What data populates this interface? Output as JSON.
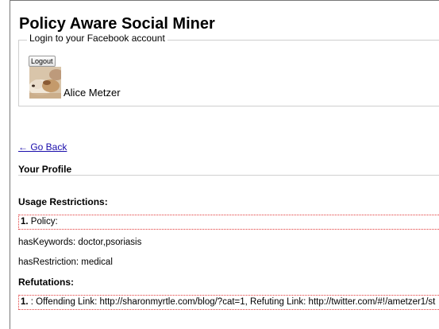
{
  "app": {
    "title": "Policy Aware Social Miner"
  },
  "login": {
    "legend": "Login to your Facebook account",
    "logout_label": "Logout",
    "user_name": "Alice Metzer"
  },
  "nav": {
    "go_back": "← Go Back"
  },
  "profile": {
    "title": "Your Profile"
  },
  "usage": {
    "title": "Usage Restrictions:",
    "policy_number": "1.",
    "policy_label": " Policy:",
    "has_keywords": "hasKeywords: doctor,psoriasis",
    "has_restriction": "hasRestriction: medical"
  },
  "refutations": {
    "title": "Refutations:",
    "item_number": "1.",
    "item_text": " : Offending Link: http://sharonmyrtle.com/blog/?cat=1, Refuting Link: http://twitter.com/#!/ametzer1/st"
  },
  "colors": {
    "link": "#1a0dab",
    "dotted_border": "#e23a3a"
  }
}
